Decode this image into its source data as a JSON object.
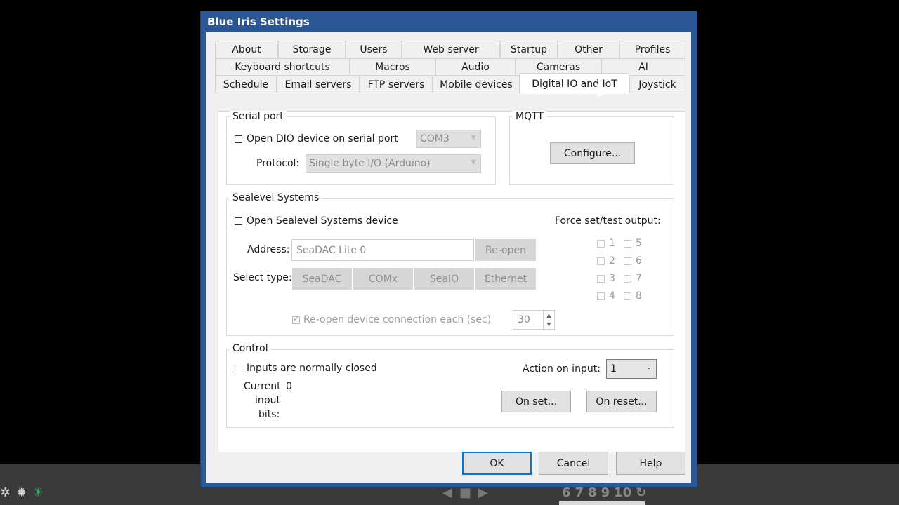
{
  "dialog": {
    "title": "Blue Iris Settings",
    "tabs_row1": [
      "About",
      "Storage",
      "Users",
      "Web server",
      "Startup",
      "Other",
      "Profiles"
    ],
    "tabs_row2": [
      "Keyboard shortcuts",
      "Macros",
      "Audio",
      "Cameras",
      "AI"
    ],
    "tabs_row3": [
      "Schedule",
      "Email servers",
      "FTP servers",
      "Mobile devices",
      "Digital IO and IoT",
      "Joystick"
    ],
    "active_tab": "Digital IO and IoT"
  },
  "serial": {
    "group_label": "Serial port",
    "open_label": "Open DIO device on serial port",
    "open_checked": false,
    "port_value": "COM3",
    "protocol_label": "Protocol:",
    "protocol_value": "Single byte I/O (Arduino)"
  },
  "mqtt": {
    "group_label": "MQTT",
    "configure_label": "Configure..."
  },
  "sealevel": {
    "group_label": "Sealevel Systems",
    "open_label": "Open Sealevel Systems device",
    "open_checked": false,
    "address_label": "Address:",
    "address_value": "SeaDAC Lite 0",
    "reopen_label": "Re-open",
    "select_type_label": "Select type:",
    "types": [
      "SeaDAC",
      "COMx",
      "SeaIO",
      "Ethernet"
    ],
    "reopen_each_label": "Re-open device connection each (sec)",
    "reopen_each_checked": true,
    "reopen_each_value": "30",
    "force_label": "Force set/test output:",
    "outputs": [
      "1",
      "2",
      "3",
      "4",
      "5",
      "6",
      "7",
      "8"
    ]
  },
  "control": {
    "group_label": "Control",
    "inputs_closed_label": "Inputs are normally closed",
    "inputs_closed_checked": false,
    "action_label": "Action on input:",
    "action_value": "1",
    "current_bits_label_1": "Current",
    "current_bits_label_2": "input",
    "current_bits_label_3": "bits:",
    "current_bits_value": "0",
    "on_set_label": "On set...",
    "on_reset_label": "On reset..."
  },
  "footer": {
    "ok_label": "OK",
    "cancel_label": "Cancel",
    "help_label": "Help"
  },
  "host": {
    "numbers": [
      "6",
      "7",
      "8",
      "9",
      "10"
    ]
  },
  "colors": {
    "titlebar": "#2b5797",
    "default_button_border": "#0078d7"
  }
}
